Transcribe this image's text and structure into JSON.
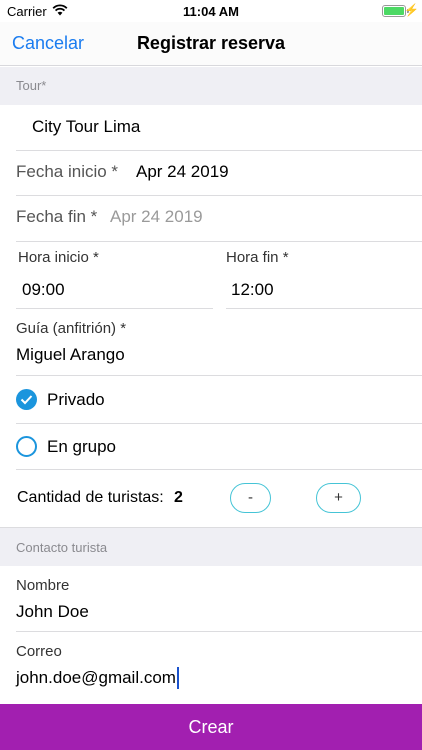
{
  "status_bar": {
    "carrier": "Carrier",
    "time": "11:04 AM"
  },
  "nav": {
    "cancel_label": "Cancelar",
    "title": "Registrar reserva"
  },
  "sections": {
    "tour": "Tour*",
    "contact": "Contacto turista"
  },
  "tour": {
    "value": "City Tour Lima"
  },
  "fecha_inicio": {
    "label": "Fecha inicio *",
    "value": "Apr 24 2019"
  },
  "fecha_fin": {
    "label": "Fecha fin *",
    "placeholder": "Apr 24 2019"
  },
  "hora_inicio": {
    "label": "Hora inicio *",
    "value": "09:00"
  },
  "hora_fin": {
    "label": "Hora fin *",
    "value": "12:00"
  },
  "guia": {
    "label": "Guía (anfitrión) *",
    "value": "Miguel Arango"
  },
  "options": {
    "privado": {
      "label": "Privado",
      "checked": true
    },
    "grupo": {
      "label": "En grupo",
      "checked": false
    }
  },
  "cantidad": {
    "label": "Cantidad de turistas:",
    "value": "2",
    "minus": "-",
    "plus": "+"
  },
  "nombre": {
    "label": "Nombre",
    "value": "John Doe"
  },
  "correo": {
    "label": "Correo",
    "value": "john.doe@gmail.com"
  },
  "create_label": "Crear",
  "colors": {
    "accent_blue": "#1a7cf0",
    "radio_blue": "#1b95dd",
    "stepper_border": "#45c4d6",
    "button_purple": "#a21fb0",
    "battery_green": "#4cd964"
  }
}
